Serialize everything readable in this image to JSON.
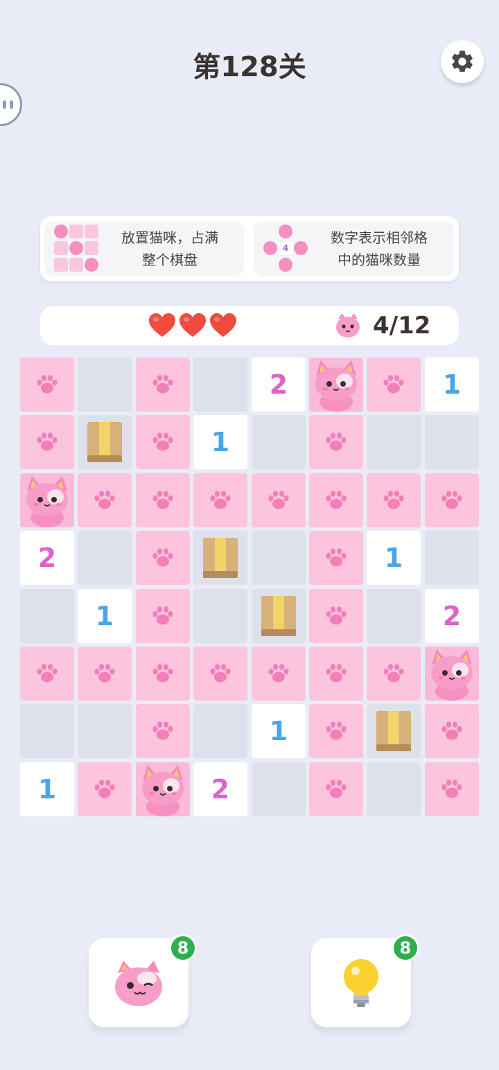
{
  "header": {
    "level_title": "第128关",
    "settings_icon": "gear-icon",
    "side_icon": "chat-bubble-icon"
  },
  "tips": [
    {
      "text": "放置猫咪，占满\n整个棋盘",
      "icon": "board-full-of-cats-icon"
    },
    {
      "text": "数字表示相邻格\n中的猫咪数量",
      "icon": "adjacent-number-icon",
      "example_number": "4"
    }
  ],
  "status": {
    "lives": 3,
    "counter_icon": "cat-face-icon",
    "cats_placed": "4/12"
  },
  "board": {
    "rows": [
      [
        "paw",
        "empty",
        "paw",
        "empty",
        "2",
        "cat",
        "paw",
        "1"
      ],
      [
        "paw",
        "box",
        "paw",
        "1",
        "empty",
        "paw",
        "empty",
        "empty"
      ],
      [
        "cat",
        "paw",
        "paw",
        "paw",
        "paw",
        "paw",
        "paw",
        "paw"
      ],
      [
        "2",
        "empty",
        "paw",
        "box",
        "empty",
        "paw",
        "1",
        "empty"
      ],
      [
        "empty",
        "1",
        "paw",
        "empty",
        "box",
        "paw",
        "empty",
        "2"
      ],
      [
        "paw",
        "paw",
        "paw",
        "paw",
        "paw",
        "paw",
        "paw",
        "cat"
      ],
      [
        "empty",
        "empty",
        "paw",
        "empty",
        "1",
        "paw",
        "box",
        "paw"
      ],
      [
        "1",
        "paw",
        "cat",
        "2",
        "empty",
        "paw",
        "empty",
        "paw"
      ]
    ]
  },
  "tools": {
    "place_cat": {
      "icon": "winking-cat-icon",
      "count": "8"
    },
    "hint": {
      "icon": "lightbulb-icon",
      "count": "8"
    }
  },
  "colors": {
    "background": "#e9ecf7",
    "paw_cell": "#fdc4de",
    "empty_cell": "#dce1ea",
    "number_one": "#4aa6e8",
    "number_two": "#de63c9",
    "badge": "#2fb04d"
  }
}
